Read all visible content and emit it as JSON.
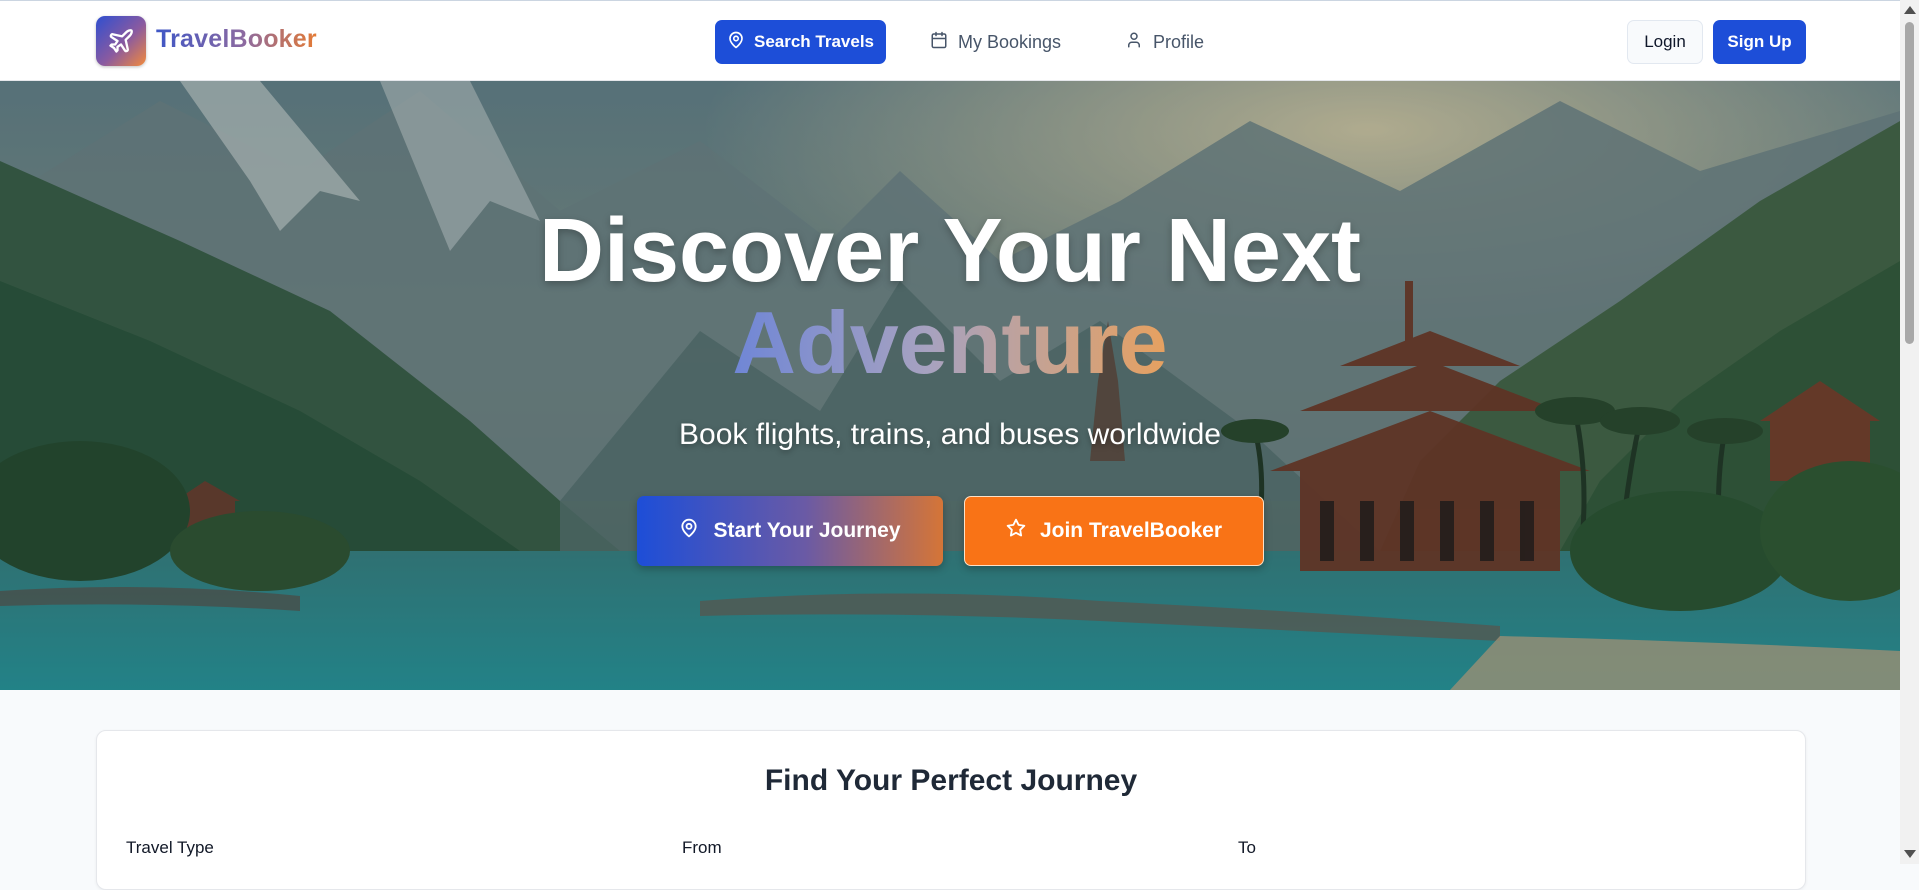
{
  "brand": {
    "name": "TravelBooker",
    "logo_icon": "airplane-icon"
  },
  "nav": {
    "search_label": "Search Travels",
    "bookings_label": "My Bookings",
    "profile_label": "Profile"
  },
  "auth": {
    "login_label": "Login",
    "signup_label": "Sign Up"
  },
  "hero": {
    "title_line1": "Discover Your Next",
    "title_line2": "Adventure",
    "subtitle": "Book flights, trains, and buses worldwide",
    "cta_primary": "Start Your Journey",
    "cta_secondary": "Join TravelBooker"
  },
  "search_card": {
    "title": "Find Your Perfect Journey",
    "fields": [
      {
        "label": "Travel Type"
      },
      {
        "label": "From"
      },
      {
        "label": "To"
      }
    ]
  },
  "colors": {
    "primary": "#1d4ed8",
    "accent_orange": "#f97316",
    "text_muted": "#475569",
    "page_bg": "#f8fafc"
  }
}
